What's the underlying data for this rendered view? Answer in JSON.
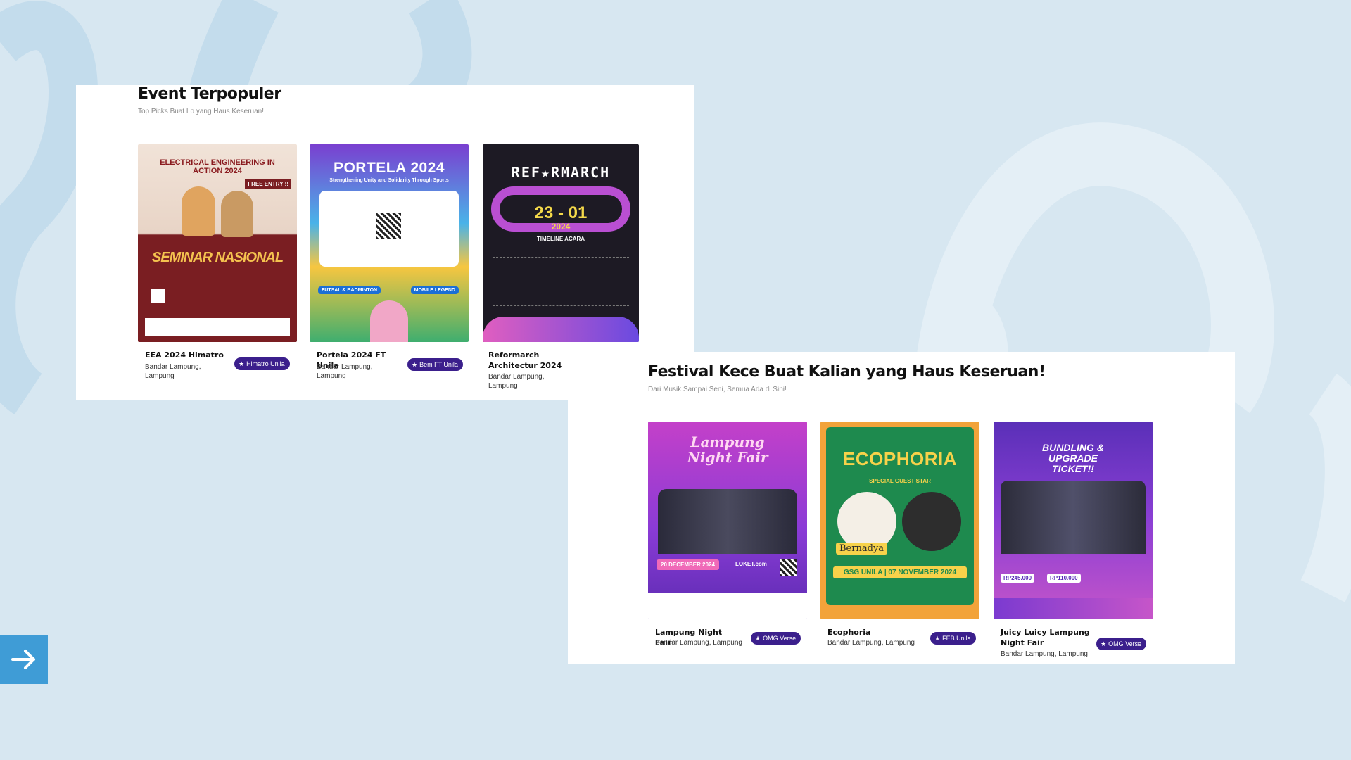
{
  "colors": {
    "background": "#d7e7f1",
    "badge": "#3b1f8c",
    "arrow_button": "#3f9cd6"
  },
  "section_popular": {
    "title": "Event Terpopuler",
    "subtitle": "Top Picks Buat Lo yang Haus Keseruan!",
    "cards": [
      {
        "title": "EEA 2024 Himatro",
        "location": "Bandar Lampung, Lampung",
        "badge": "Himatro Unila",
        "poster": {
          "heading": "ELECTRICAL ENGINEERING IN ACTION 2024",
          "tag": "FREE ENTRY !!",
          "main": "SEMINAR NASIONAL"
        }
      },
      {
        "title": "Portela 2024 FT Unila",
        "location": "Bandar Lampung, Lampung",
        "badge": "Bem FT Unila",
        "poster": {
          "heading": "PORTELA 2024",
          "tagline": "Strengthening Unity and Solidarity Through Sports",
          "left_label": "FUTSAL & BADMINTON",
          "right_label": "MOBILE LEGEND"
        }
      },
      {
        "title": "Reformarch Architectur 2024",
        "location": "Bandar Lampung, Lampung",
        "badge": "",
        "poster": {
          "heading": "REF★RMARCH",
          "dates": "23 - 01",
          "year": "2024",
          "timeline": "TIMELINE ACARA"
        }
      }
    ]
  },
  "section_festival": {
    "title": "Festival Kece Buat Kalian yang Haus Keseruan!",
    "subtitle": "Dari Musik Sampai Seni, Semua Ada di Sini!",
    "cards": [
      {
        "title": "Lampung Night Fair",
        "location": "Bandar Lampung, Lampung",
        "badge": "OMG Verse",
        "poster": {
          "heading": "Lampung Night Fair",
          "date": "20 DECEMBER 2024",
          "ticket": "LOKET.com"
        }
      },
      {
        "title": "Ecophoria",
        "location": "Bandar Lampung, Lampung",
        "badge": "FEB Unila",
        "poster": {
          "heading": "ECOPHORIA",
          "special": "SPECIAL GUEST STAR",
          "guest": "Bernadya",
          "venue": "GSG UNILA | 07 NOVEMBER 2024"
        }
      },
      {
        "title": "Juicy Luicy Lampung Night Fair",
        "location": "Bandar Lampung, Lampung",
        "badge": "OMG Verse",
        "poster": {
          "heading": "BUNDLING & UPGRADE TICKET!!",
          "price_1": "RP245.000",
          "price_2": "RP110.000"
        }
      }
    ]
  }
}
